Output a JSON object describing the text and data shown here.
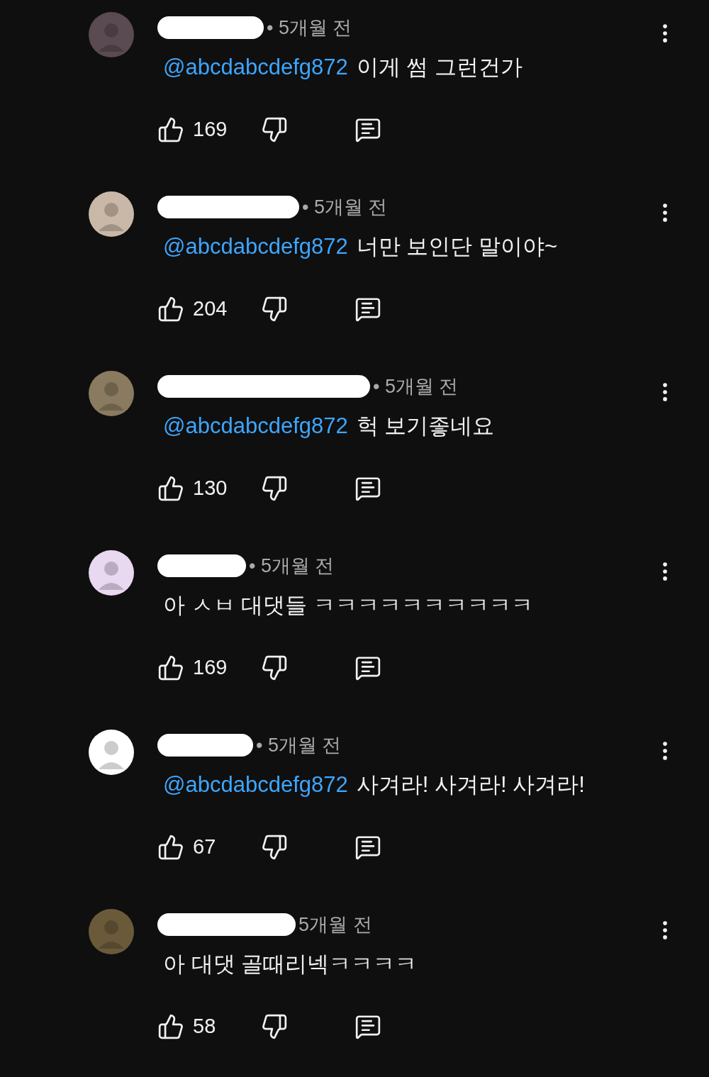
{
  "comments": [
    {
      "time": "• 5개월 전",
      "mention": "@abcdabcdefg872",
      "text": "이게 썸 그런건가",
      "likes": "169"
    },
    {
      "time": "• 5개월 전",
      "mention": "@abcdabcdefg872",
      "text": "너만 보인단 말이야~",
      "likes": "204"
    },
    {
      "time": "• 5개월 전",
      "mention": "@abcdabcdefg872",
      "text": "헉 보기좋네요",
      "likes": "130"
    },
    {
      "time": "• 5개월 전",
      "text": "아 ㅅㅂ 대댓들 ㅋㅋㅋㅋㅋㅋㅋㅋㅋㅋ",
      "likes": "169"
    },
    {
      "time": "• 5개월 전",
      "mention": "@abcdabcdefg872",
      "text": "사겨라! 사겨라! 사겨라!",
      "likes": "67"
    },
    {
      "time": "5개월 전",
      "text": "아 대댓 골때리넥ㅋㅋㅋㅋ",
      "likes": "58"
    }
  ]
}
